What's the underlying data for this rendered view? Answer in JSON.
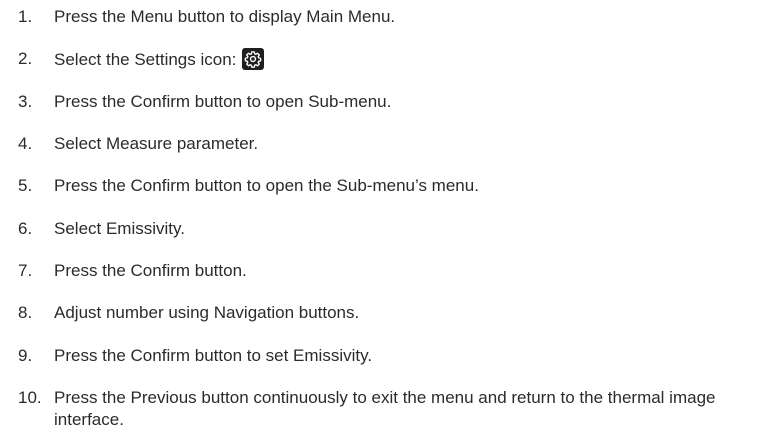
{
  "steps": [
    {
      "number": "1.",
      "text": "Press the Menu button to display Main Menu."
    },
    {
      "number": "2.",
      "text": "Select the Settings icon:",
      "icon": "settings-gear-icon"
    },
    {
      "number": "3.",
      "text": "Press the Confirm button to open Sub-menu."
    },
    {
      "number": "4.",
      "text": "Select Measure parameter."
    },
    {
      "number": "5.",
      "text": "Press the Confirm button to open the Sub-menu’s menu."
    },
    {
      "number": "6.",
      "text": "Select Emissivity."
    },
    {
      "number": "7.",
      "text": "Press the Confirm button."
    },
    {
      "number": "8.",
      "text": "Adjust number using Navigation buttons."
    },
    {
      "number": "9.",
      "text": "Press the Confirm button to set Emissivity."
    },
    {
      "number": "10.",
      "text": "Press the Previous button continuously to exit the menu and return to the thermal image interface."
    }
  ]
}
